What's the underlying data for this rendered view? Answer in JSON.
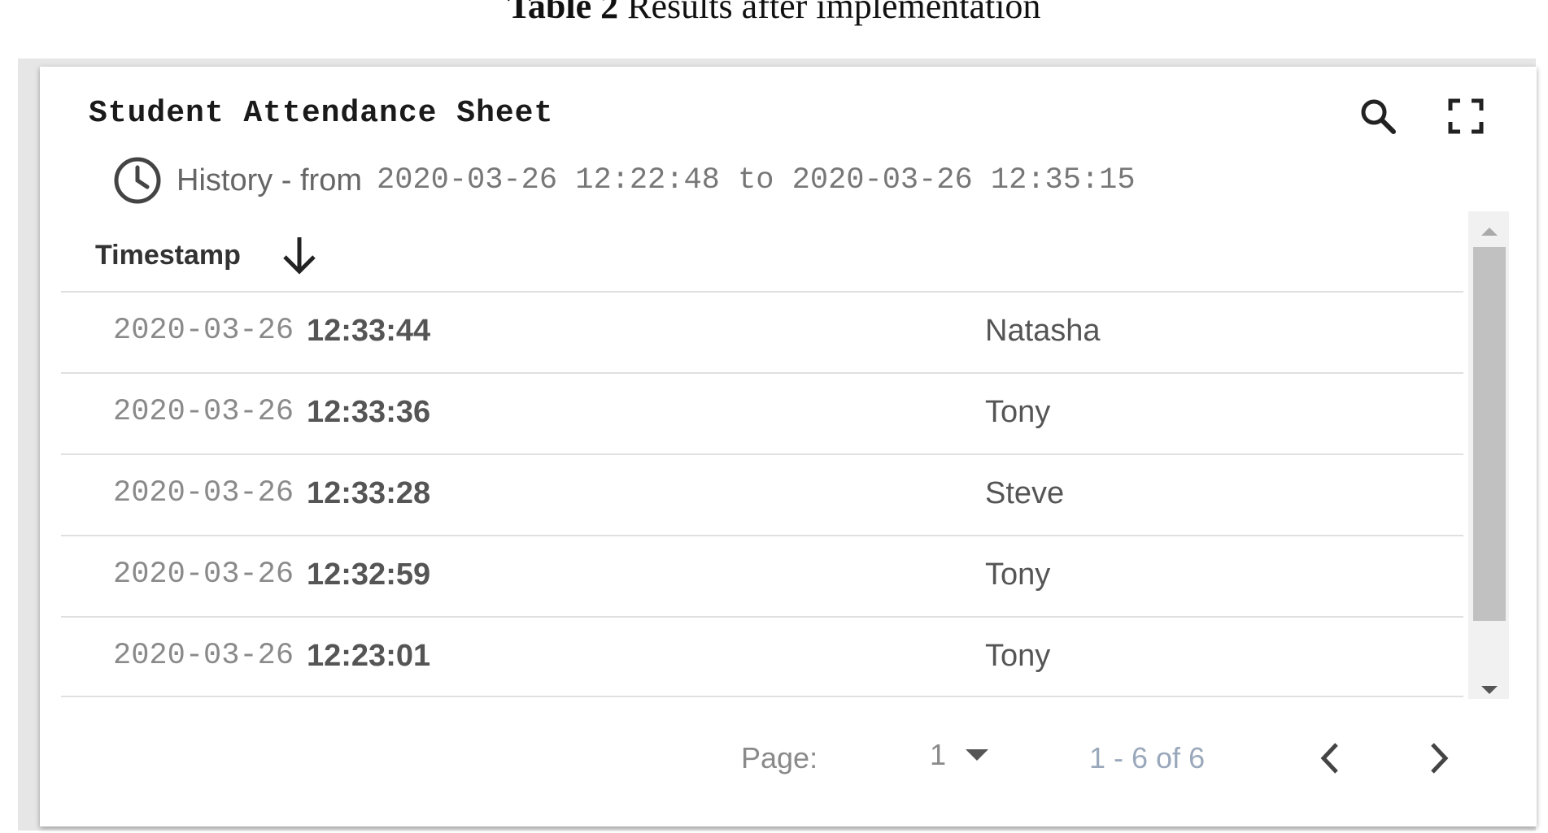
{
  "caption": {
    "bold": "Table 2",
    "text": " Results after implementation"
  },
  "card": {
    "title": "Student Attendance Sheet",
    "history_label": "History - from",
    "history_range": "2020-03-26 12:22:48 to 2020-03-26 12:35:15",
    "column_header": "Timestamp",
    "rows": [
      {
        "date": "2020-03-26",
        "time": "12:33:44",
        "name": "Natasha"
      },
      {
        "date": "2020-03-26",
        "time": "12:33:36",
        "name": "Tony"
      },
      {
        "date": "2020-03-26",
        "time": "12:33:28",
        "name": "Steve"
      },
      {
        "date": "2020-03-26",
        "time": "12:32:59",
        "name": "Tony"
      },
      {
        "date": "2020-03-26",
        "time": "12:23:01",
        "name": "Tony"
      }
    ],
    "pager": {
      "label": "Page:",
      "page": "1",
      "range": "1 - 6 of 6"
    }
  },
  "icons": [
    "search-icon",
    "fullscreen-icon",
    "clock-icon",
    "sort-down-arrow-icon",
    "caret-down-icon",
    "chevron-left-icon",
    "chevron-right-icon"
  ]
}
